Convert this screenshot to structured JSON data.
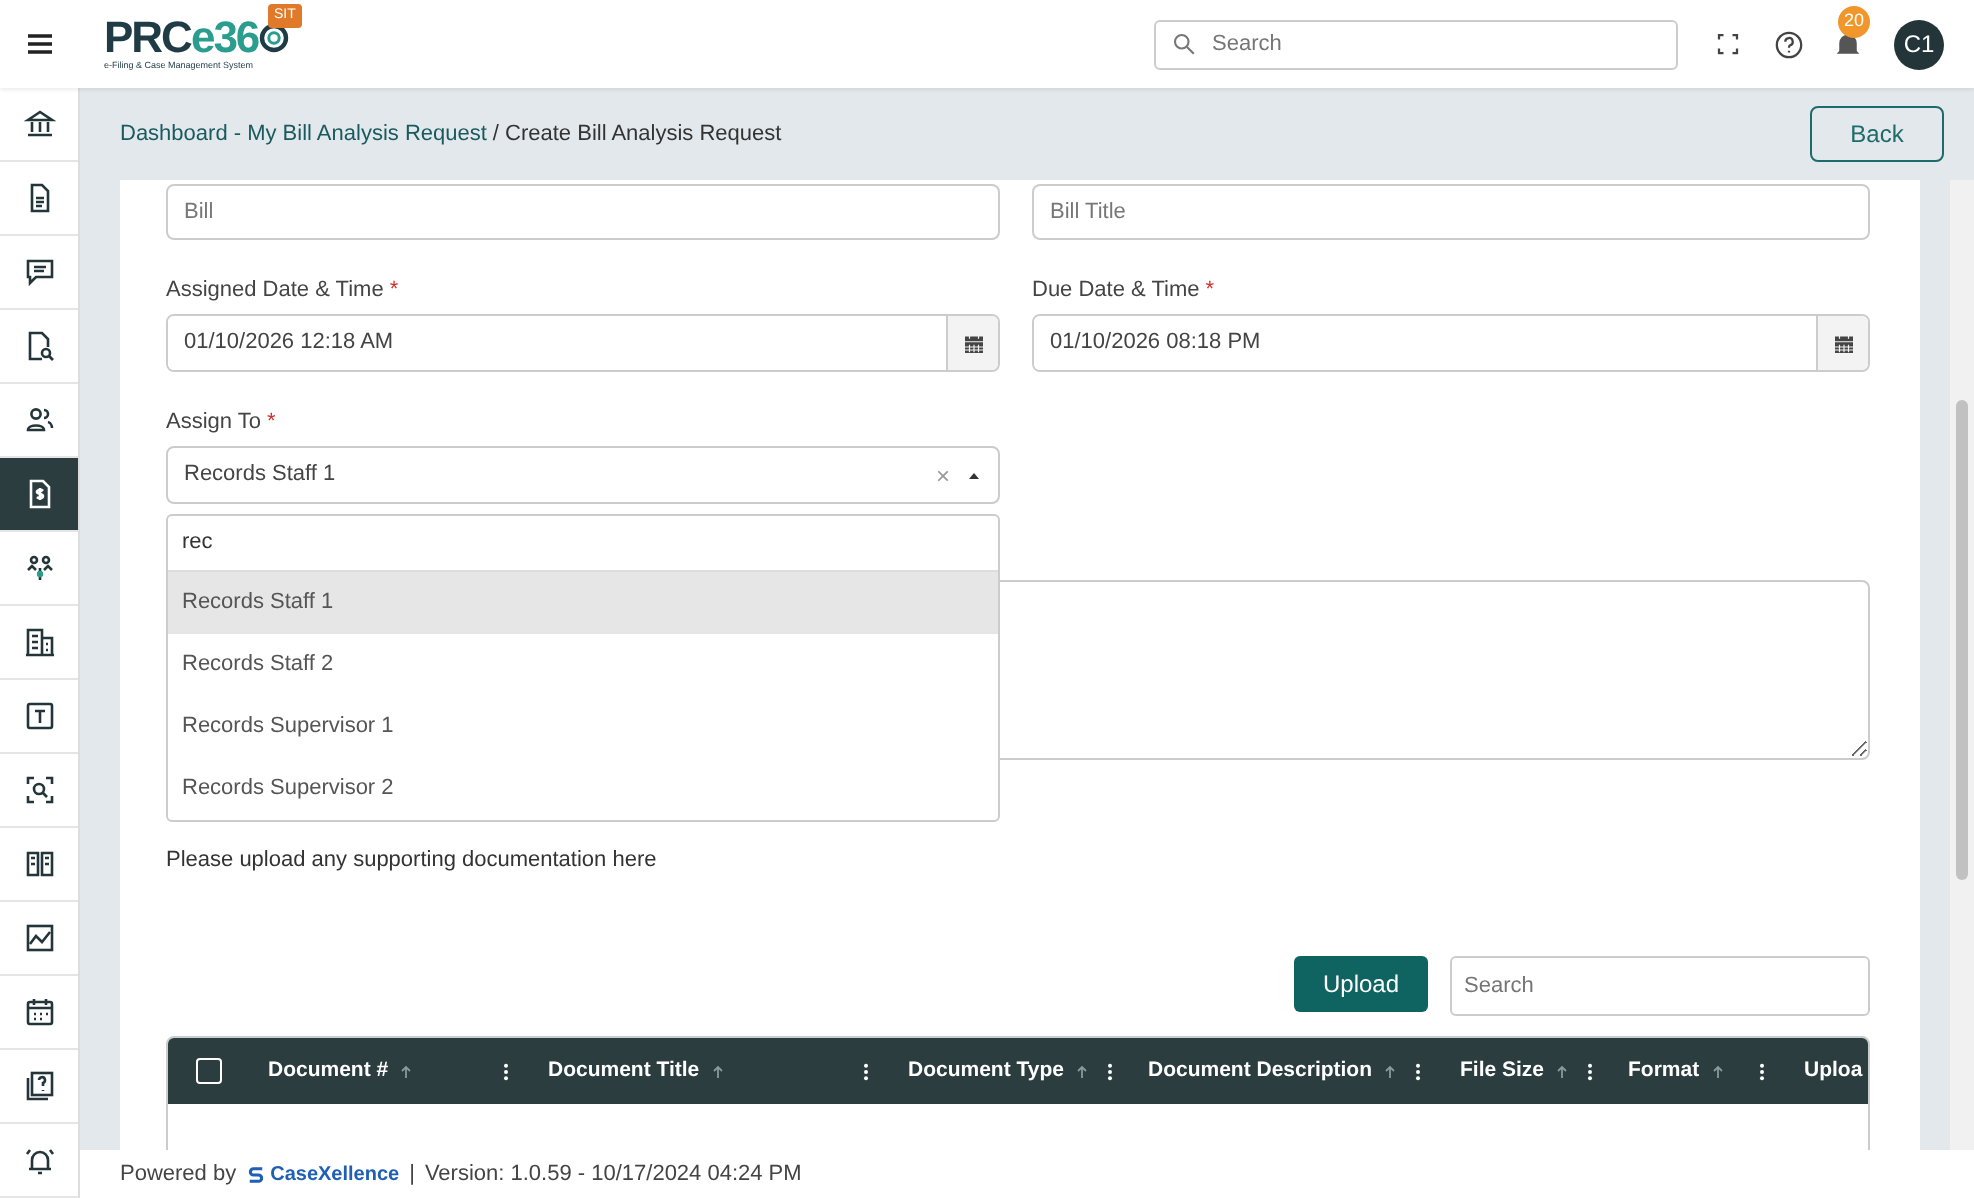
{
  "header": {
    "logo": {
      "primary": "PRC",
      "accent": "e36",
      "tagline": "e-Filing & Case Management System"
    },
    "environment_badge": "SIT",
    "search": {
      "placeholder": "Search"
    },
    "notifications_count": "20",
    "avatar": "C1"
  },
  "sidebar": {
    "items": [
      {
        "selected": false
      },
      {
        "selected": false
      },
      {
        "selected": false
      },
      {
        "selected": false
      },
      {
        "selected": false
      },
      {
        "selected": true
      },
      {
        "selected": false
      },
      {
        "selected": false
      },
      {
        "selected": false
      },
      {
        "selected": false
      },
      {
        "selected": false
      },
      {
        "selected": false
      },
      {
        "selected": false
      },
      {
        "selected": false
      },
      {
        "selected": false
      }
    ]
  },
  "breadcrumb": {
    "link": "Dashboard - My Bill Analysis Request",
    "separator": "/",
    "current": "Create Bill Analysis Request"
  },
  "back_button": "Back",
  "form": {
    "fields": [
      {
        "kind": "text",
        "placeholder": "Bill"
      },
      {
        "kind": "text",
        "placeholder": "Bill Title"
      },
      {
        "kind": "date",
        "label": "Assigned Date & Time",
        "required_mark": "*",
        "value": "01/10/2026 12:18 AM"
      },
      {
        "kind": "date",
        "label": "Due Date & Time",
        "required_mark": "*",
        "value": "01/10/2026 08:18 PM"
      }
    ],
    "assign_to": {
      "label": "Assign To",
      "required_mark": "*",
      "value": "Records Staff 1",
      "clear": "×",
      "expanded": true,
      "search_value": "rec",
      "options": [
        {
          "label": "Records Staff 1",
          "selected": true
        },
        {
          "label": "Records Staff 2",
          "selected": false
        },
        {
          "label": "Records Supervisor 1",
          "selected": false
        },
        {
          "label": "Records Supervisor 2",
          "selected": false
        }
      ]
    }
  },
  "attachments": {
    "hint": "Please upload any supporting documentation here",
    "upload_button": "Upload",
    "search": {
      "placeholder": "Search"
    },
    "table": {
      "select_all_checked": false,
      "columns": [
        {
          "label": "Document #"
        },
        {
          "label": "Document Title"
        },
        {
          "label": "Document Type"
        },
        {
          "label": "Document Description"
        },
        {
          "label": "File Size"
        },
        {
          "label": "Format"
        },
        {
          "label": "Uploa"
        }
      ]
    }
  },
  "footer": {
    "powered_by": "Powered by",
    "brand": "CaseXellence",
    "separator": "|",
    "version": "Version: 1.0.59 - 10/17/2024 04:24 PM"
  }
}
